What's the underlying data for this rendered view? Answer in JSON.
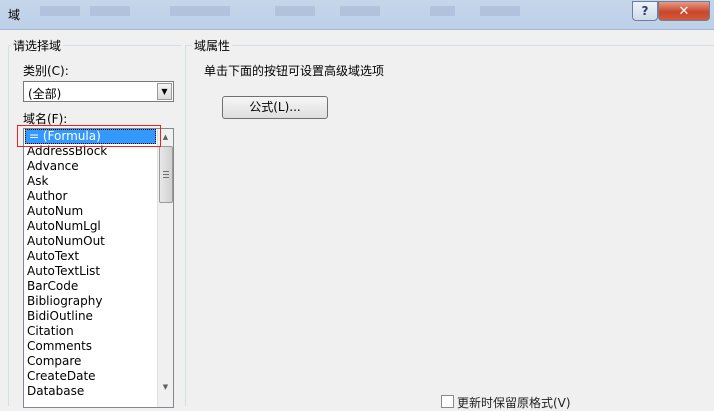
{
  "window": {
    "title": "域",
    "help_label": "?",
    "close_label": "✕"
  },
  "left_group": {
    "title": "请选择域",
    "category_label": "类别(C):",
    "category_value": "(全部)",
    "field_names_label": "域名(F):",
    "field_names": [
      "= (Formula)",
      "AddressBlock",
      "Advance",
      "Ask",
      "Author",
      "AutoNum",
      "AutoNumLgl",
      "AutoNumOut",
      "AutoText",
      "AutoTextList",
      "BarCode",
      "Bibliography",
      "BidiOutline",
      "Citation",
      "Comments",
      "Compare",
      "CreateDate",
      "Database"
    ],
    "selected_index": 0
  },
  "right_group": {
    "title": "域属性",
    "hint": "单击下面的按钮可设置高级域选项",
    "formula_button": "公式(L)..."
  },
  "bottom": {
    "preserve_format_label": "更新时保留原格式(V)"
  },
  "colors": {
    "selection": "#3399ff",
    "annotation_box": "#e8221c",
    "close_button": "#c8472c"
  }
}
